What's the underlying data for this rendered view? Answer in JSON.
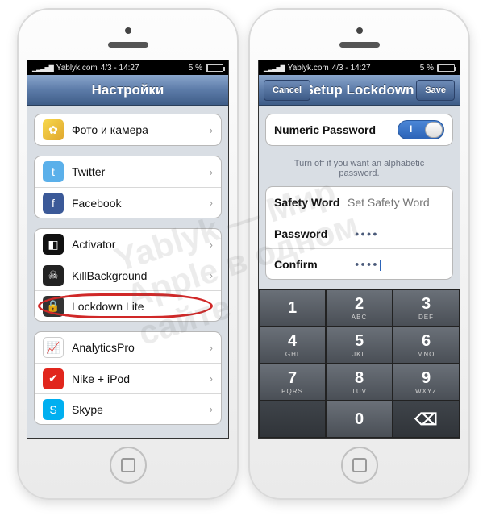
{
  "watermark": "Yablyk — Мир Apple в одном сайте",
  "status": {
    "carrier": "Yablyk.com",
    "time": "4/3 - 14:27",
    "battery": "5 %"
  },
  "left": {
    "title": "Настройки",
    "groups": [
      {
        "rows": [
          {
            "icon": "i-photo",
            "glyph": "✿",
            "label": "Фото и камера",
            "name": "row-photo"
          }
        ]
      },
      {
        "rows": [
          {
            "icon": "i-tw",
            "glyph": "t",
            "label": "Twitter",
            "name": "row-twitter"
          },
          {
            "icon": "i-fb",
            "glyph": "f",
            "label": "Facebook",
            "name": "row-facebook"
          }
        ]
      },
      {
        "rows": [
          {
            "icon": "i-act",
            "glyph": "◧",
            "label": "Activator",
            "name": "row-activator"
          },
          {
            "icon": "i-kb",
            "glyph": "☠",
            "label": "KillBackground",
            "name": "row-killbg"
          },
          {
            "icon": "i-ld",
            "glyph": "🔒",
            "label": "Lockdown Lite",
            "name": "row-lockdown",
            "circled": true
          }
        ]
      },
      {
        "rows": [
          {
            "icon": "i-ap",
            "glyph": "📈",
            "label": "AnalyticsPro",
            "name": "row-analytics"
          },
          {
            "icon": "i-nk",
            "glyph": "✔",
            "label": "Nike + iPod",
            "name": "row-nike"
          },
          {
            "icon": "i-sk",
            "glyph": "S",
            "label": "Skype",
            "name": "row-skype"
          }
        ]
      }
    ]
  },
  "right": {
    "title": "Setup Lockdown",
    "cancel": "Cancel",
    "save": "Save",
    "numericLabel": "Numeric Password",
    "hint": "Turn off if you want an alphabetic password.",
    "safetyLabel": "Safety Word",
    "safetyPlaceholder": "Set Safety Word",
    "passwordLabel": "Password",
    "passwordValue": "●●●●",
    "confirmLabel": "Confirm",
    "confirmValue": "●●●●",
    "keys": [
      {
        "d": "1",
        "s": ""
      },
      {
        "d": "2",
        "s": "ABC"
      },
      {
        "d": "3",
        "s": "DEF"
      },
      {
        "d": "4",
        "s": "GHI"
      },
      {
        "d": "5",
        "s": "JKL"
      },
      {
        "d": "6",
        "s": "MNO"
      },
      {
        "d": "7",
        "s": "PQRS"
      },
      {
        "d": "8",
        "s": "TUV"
      },
      {
        "d": "9",
        "s": "WXYZ"
      },
      {
        "d": "",
        "s": "",
        "dim": true
      },
      {
        "d": "0",
        "s": ""
      },
      {
        "d": "⌫",
        "s": "",
        "dim": true
      }
    ]
  }
}
